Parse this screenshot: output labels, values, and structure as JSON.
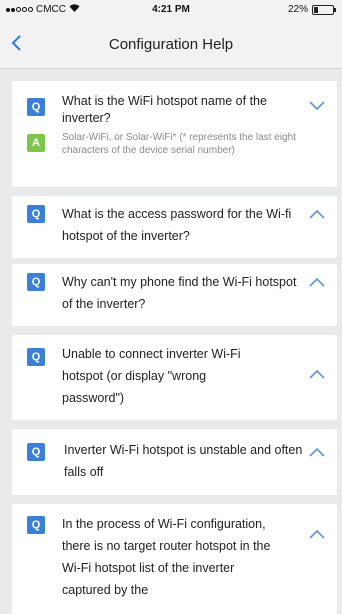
{
  "status_bar": {
    "carrier": "CMCC",
    "time": "4:21 PM",
    "battery": "22%",
    "battery_level": 0.22
  },
  "header": {
    "back_icon": "chevron-left-icon",
    "title": "Configuration Help"
  },
  "faq": [
    {
      "badge": "Q",
      "question": "What is the WiFi hotspot name of the inverter?",
      "answer_badge": "A",
      "answer": "Solar-WiFi, or Solar-WiFi* (* represents the last eight characters of the device serial number)",
      "chevron": "chevron-down-icon"
    },
    {
      "badge": "Q",
      "question": "What is the access password for the Wi-fi hotspot of the inverter?",
      "chevron": "chevron-up-icon"
    },
    {
      "badge": "Q",
      "question": "Why can't my phone find the Wi-Fi hotspot of the inverter?",
      "chevron": "chevron-up-icon"
    },
    {
      "badge": "Q",
      "question": "Unable to connect inverter Wi-Fi hotspot (or display \"wrong password\")",
      "chevron": "chevron-up-icon"
    },
    {
      "badge": "Q",
      "question": "Inverter Wi-Fi hotspot is unstable and often falls off",
      "chevron": "chevron-up-icon"
    },
    {
      "badge": "Q",
      "question": "In the process of Wi-Fi configuration, there is no target router hotspot in the Wi-Fi hotspot list of the inverter captured by the",
      "chevron": "chevron-up-icon"
    }
  ],
  "colors": {
    "accent": "#2a7ae4",
    "question_badge": "#3c7fd6",
    "answer_badge": "#7dc64e",
    "background": "#e9eaec"
  }
}
